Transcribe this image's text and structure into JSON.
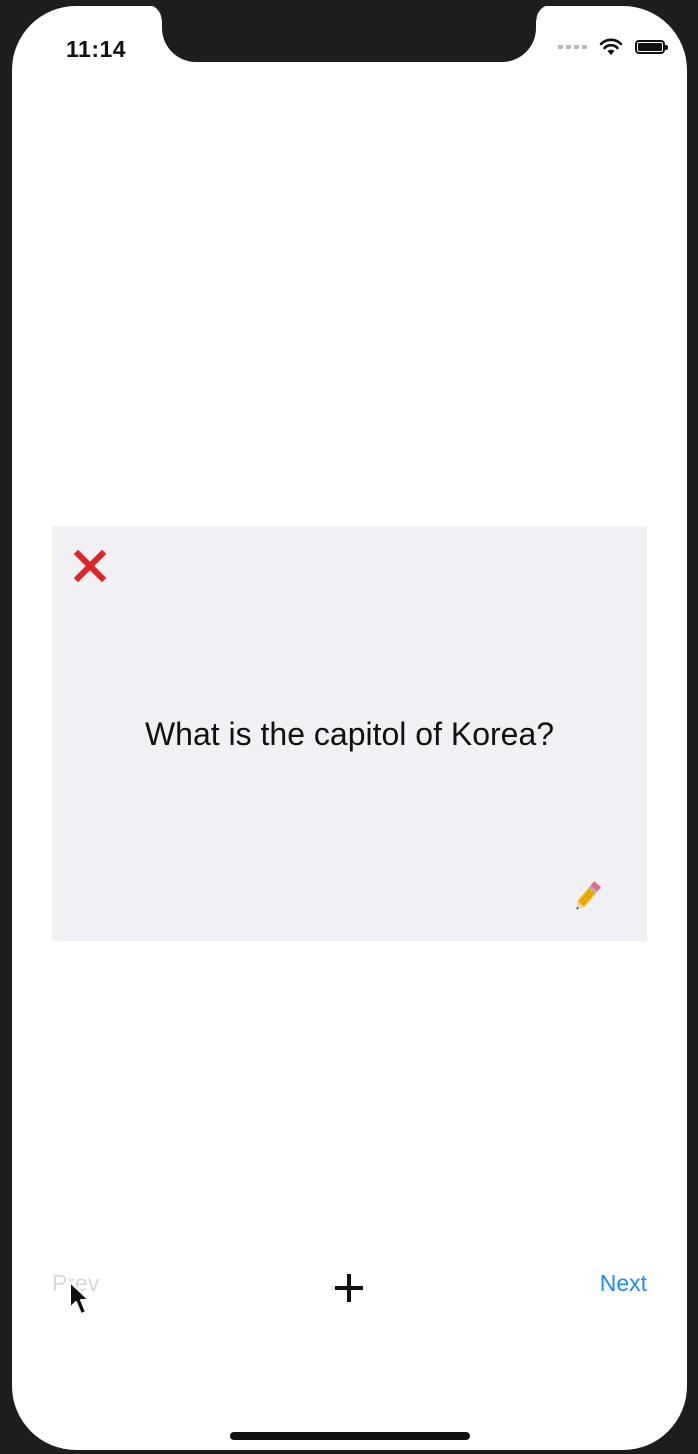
{
  "status_bar": {
    "time": "11:14"
  },
  "card": {
    "question": "What is the capitol of Korea?",
    "delete_icon": "x-mark-icon",
    "edit_icon": "pencil-icon"
  },
  "bottom_bar": {
    "prev_label": "Prev",
    "next_label": "Next",
    "add_icon": "plus-icon"
  },
  "colors": {
    "accent": "#1d8cf8",
    "delete": "#dc2626",
    "card_background": "#f1f0f5",
    "disabled_text": "#d8d8dc"
  }
}
